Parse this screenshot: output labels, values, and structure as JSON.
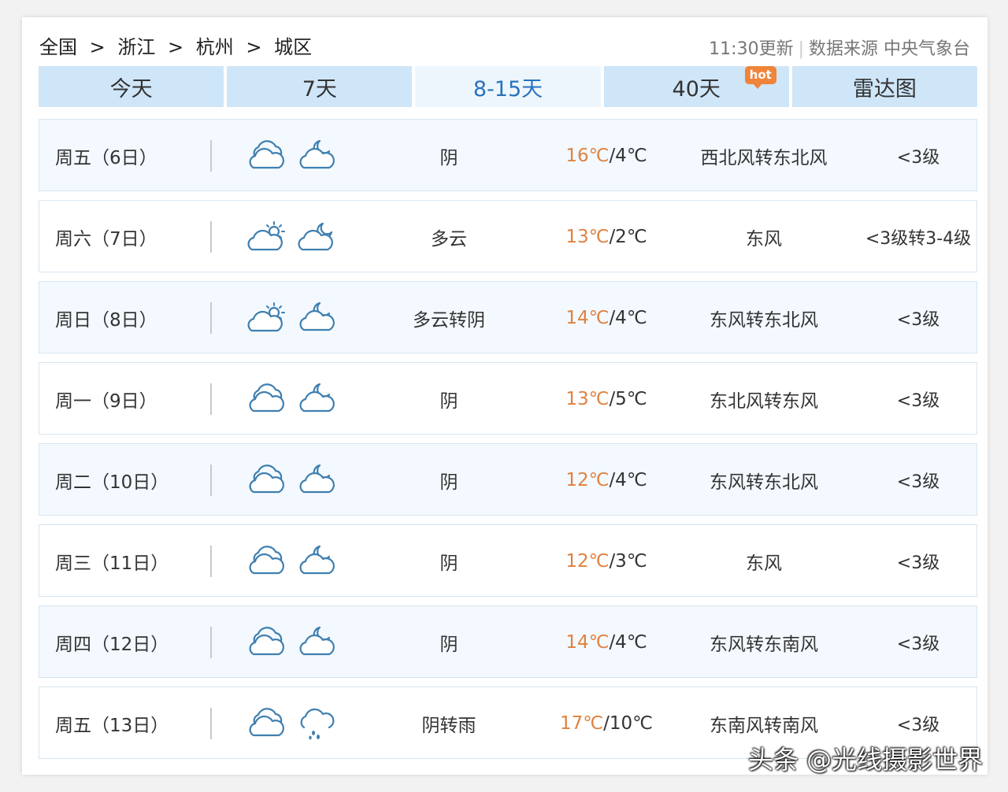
{
  "breadcrumb": [
    "全国",
    "浙江",
    "杭州",
    "城区"
  ],
  "breadcrumb_separator": ">",
  "meta": {
    "update_time": "11:30更新",
    "source": "数据来源 中央气象台"
  },
  "tabs": [
    {
      "label": "今天",
      "active": false
    },
    {
      "label": "7天",
      "active": false
    },
    {
      "label": "8-15天",
      "active": true
    },
    {
      "label": "40天",
      "active": false,
      "badge": "hot"
    },
    {
      "label": "雷达图",
      "active": false
    }
  ],
  "rows": [
    {
      "day": "周五（6日）",
      "icons": [
        "cloudy-icon",
        "cloudy-night-icon"
      ],
      "desc": "阴",
      "high": "16℃",
      "low": "/4℃",
      "wind": "西北风转东北风",
      "level": "<3级"
    },
    {
      "day": "周六（7日）",
      "icons": [
        "partly-cloudy-day-icon",
        "partly-cloudy-night-icon"
      ],
      "desc": "多云",
      "high": "13℃",
      "low": "/2℃",
      "wind": "东风",
      "level": "<3级转3-4级"
    },
    {
      "day": "周日（8日）",
      "icons": [
        "partly-cloudy-day-icon",
        "cloudy-night-icon"
      ],
      "desc": "多云转阴",
      "high": "14℃",
      "low": "/4℃",
      "wind": "东风转东北风",
      "level": "<3级"
    },
    {
      "day": "周一（9日）",
      "icons": [
        "cloudy-icon",
        "cloudy-night-icon"
      ],
      "desc": "阴",
      "high": "13℃",
      "low": "/5℃",
      "wind": "东北风转东风",
      "level": "<3级"
    },
    {
      "day": "周二（10日）",
      "icons": [
        "cloudy-icon",
        "cloudy-night-icon"
      ],
      "desc": "阴",
      "high": "12℃",
      "low": "/4℃",
      "wind": "东风转东北风",
      "level": "<3级"
    },
    {
      "day": "周三（11日）",
      "icons": [
        "cloudy-icon",
        "cloudy-night-icon"
      ],
      "desc": "阴",
      "high": "12℃",
      "low": "/3℃",
      "wind": "东风",
      "level": "<3级"
    },
    {
      "day": "周四（12日）",
      "icons": [
        "cloudy-icon",
        "cloudy-night-icon"
      ],
      "desc": "阴",
      "high": "14℃",
      "low": "/4℃",
      "wind": "东风转东南风",
      "level": "<3级"
    },
    {
      "day": "周五（13日）",
      "icons": [
        "cloudy-icon",
        "rain-icon"
      ],
      "desc": "阴转雨",
      "high": "17℃",
      "low": "/10℃",
      "wind": "东南风转南风",
      "level": "<3级"
    }
  ],
  "watermark": "头条 @光线摄影世界",
  "colors": {
    "tab_bg": "#cfe6f8",
    "tab_active_text": "#2873bd",
    "high_temp": "#e1813f",
    "icon_stroke": "#3f7fb0",
    "hot_badge": "#f0843a"
  }
}
